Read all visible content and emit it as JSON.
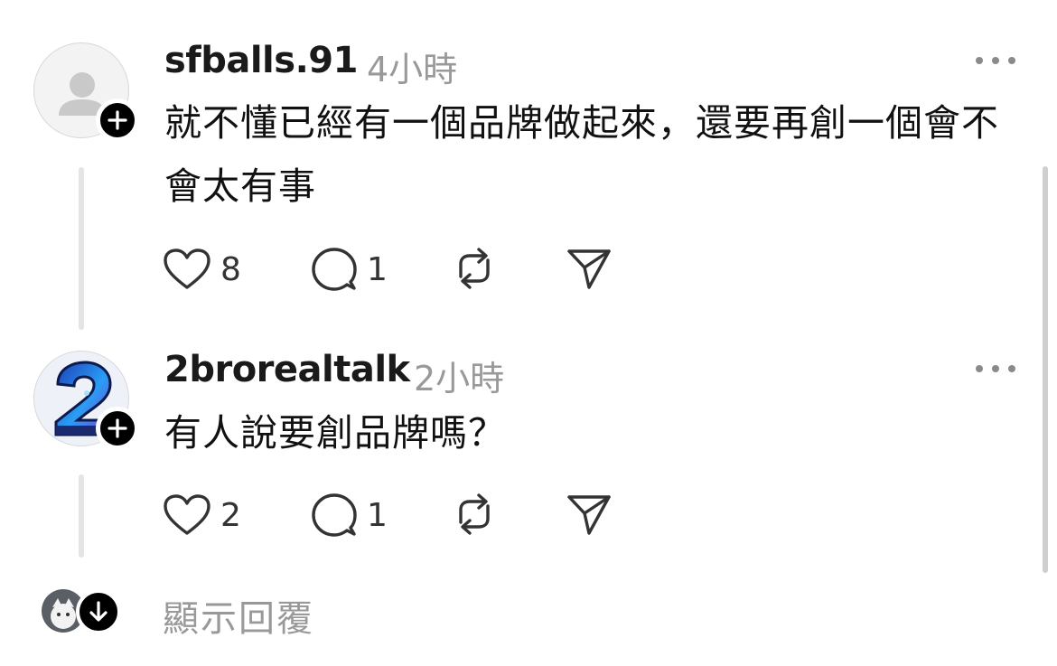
{
  "comments": [
    {
      "username": "sfballs.91",
      "time": "4小時",
      "text": "就不懂已經有一個品牌做起來，還要再創一個會不會太有事",
      "likes": "8",
      "replies": "1"
    },
    {
      "username": "2brorealtalk",
      "time": "2小時",
      "text": "有人說要創品牌嗎？",
      "likes": "2",
      "replies": "1"
    }
  ],
  "footer": {
    "show_replies_label": "顯示回覆"
  },
  "icons": {
    "like": "heart-icon",
    "reply": "comment-bubble-icon",
    "repost": "repost-icon",
    "share": "send-icon",
    "more": "more-dots-icon",
    "follow": "plus-icon",
    "expand": "arrow-down-icon"
  },
  "colors": {
    "primary_text": "#111111",
    "secondary_text": "#999999",
    "thread_line": "#e4e4e4",
    "badge": "#000000"
  }
}
